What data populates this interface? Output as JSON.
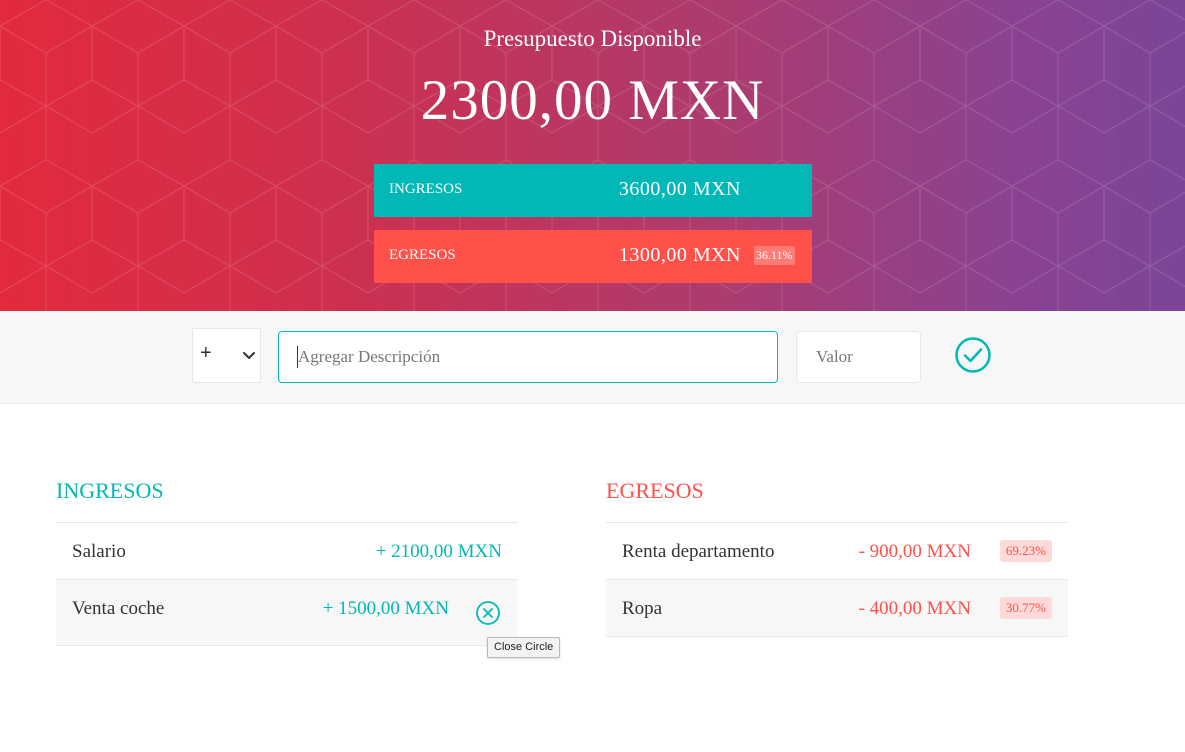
{
  "header": {
    "title": "Presupuesto Disponible",
    "available": "2300,00 MXN",
    "income": {
      "label": "INGRESOS",
      "value": "3600,00 MXN"
    },
    "expense": {
      "label": "EGRESOS",
      "value": "1300,00 MXN",
      "percentage": "36.11%"
    }
  },
  "add_form": {
    "type_options": [
      "+",
      "-"
    ],
    "type_selected": "+",
    "description_placeholder": "Agregar Descripción",
    "description_value": "",
    "value_placeholder": "Valor",
    "value_value": "",
    "submit_icon": "checkmark-circle-icon"
  },
  "income_list": {
    "title": "INGRESOS",
    "items": [
      {
        "description": "Salario",
        "amount": "+ 2100,00 MXN"
      },
      {
        "description": "Venta coche",
        "amount": "+ 1500,00 MXN"
      }
    ]
  },
  "expense_list": {
    "title": "EGRESOS",
    "items": [
      {
        "description": "Renta departamento",
        "amount": "- 900,00 MXN",
        "percentage": "69.23%"
      },
      {
        "description": "Ropa",
        "amount": "- 400,00 MXN",
        "percentage": "30.77%"
      }
    ]
  },
  "tooltip": "Close Circle",
  "colors": {
    "income": "#02b8b6",
    "expense": "#ff5049",
    "gradient_start": "#e32a3d",
    "gradient_end": "#7c4597"
  }
}
